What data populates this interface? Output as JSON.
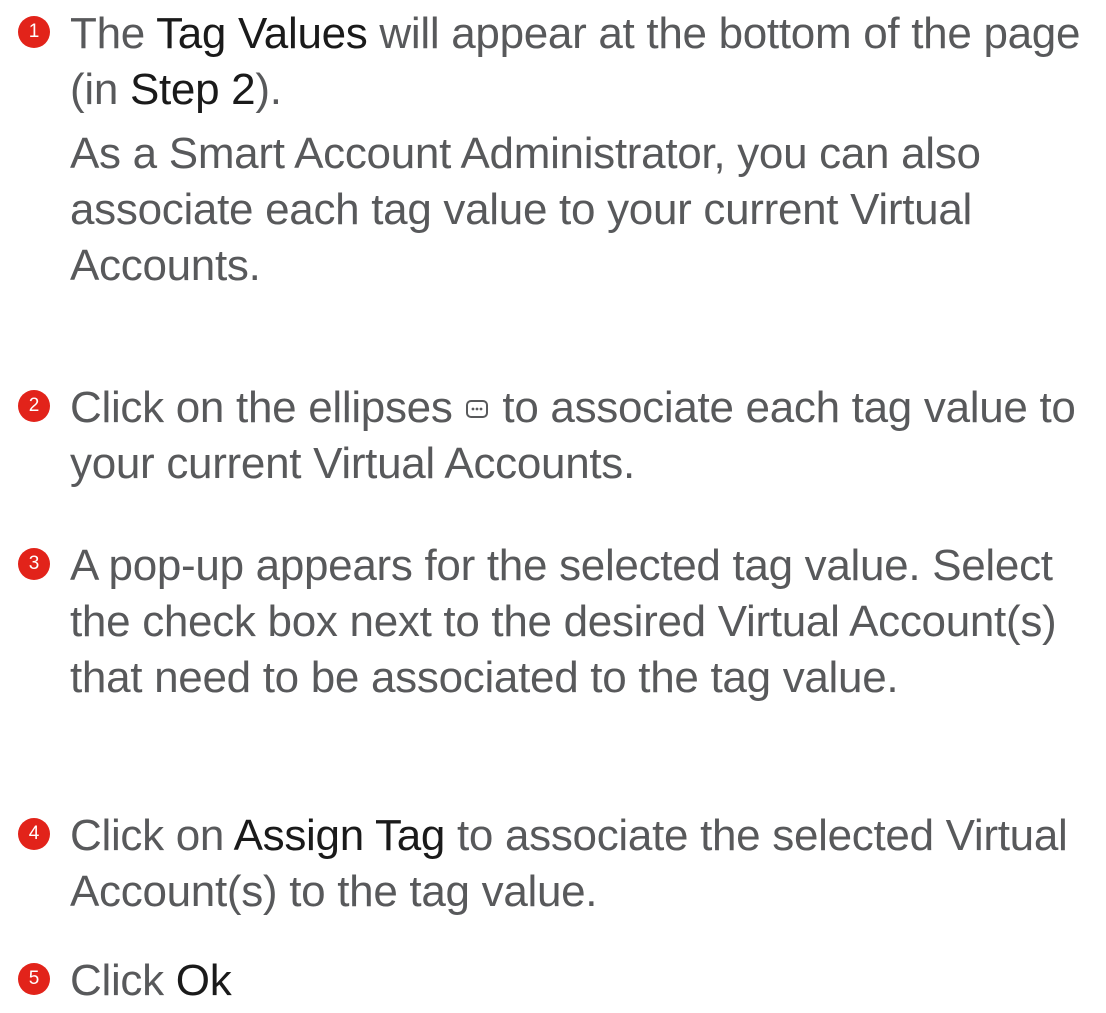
{
  "accent_color": "#e2231a",
  "text_color": "#58595b",
  "steps": [
    {
      "number": "1",
      "p1_pre": "The ",
      "p1_hl1": "Tag Values",
      "p1_mid": " will appear at the bottom of the page (in ",
      "p1_hl2": "Step 2",
      "p1_post": ").",
      "p2": "As a Smart Account Administrator, you can also associate each tag value to your current Virtual Accounts."
    },
    {
      "number": "2",
      "pre": "Click on the ellipses ",
      "icon": "ellipsis-icon",
      "post": " to associate each tag value to your current Virtual Accounts."
    },
    {
      "number": "3",
      "text": "A pop-up appears for the selected tag value. Select the check box next to the desired Virtual Account(s) that need to be associated to the tag value."
    },
    {
      "number": "4",
      "pre": "Click on ",
      "hl": "Assign Tag",
      "post": " to associate the selected Virtual Account(s) to the tag value."
    },
    {
      "number": "5",
      "pre": "Click ",
      "hl": "Ok"
    }
  ]
}
